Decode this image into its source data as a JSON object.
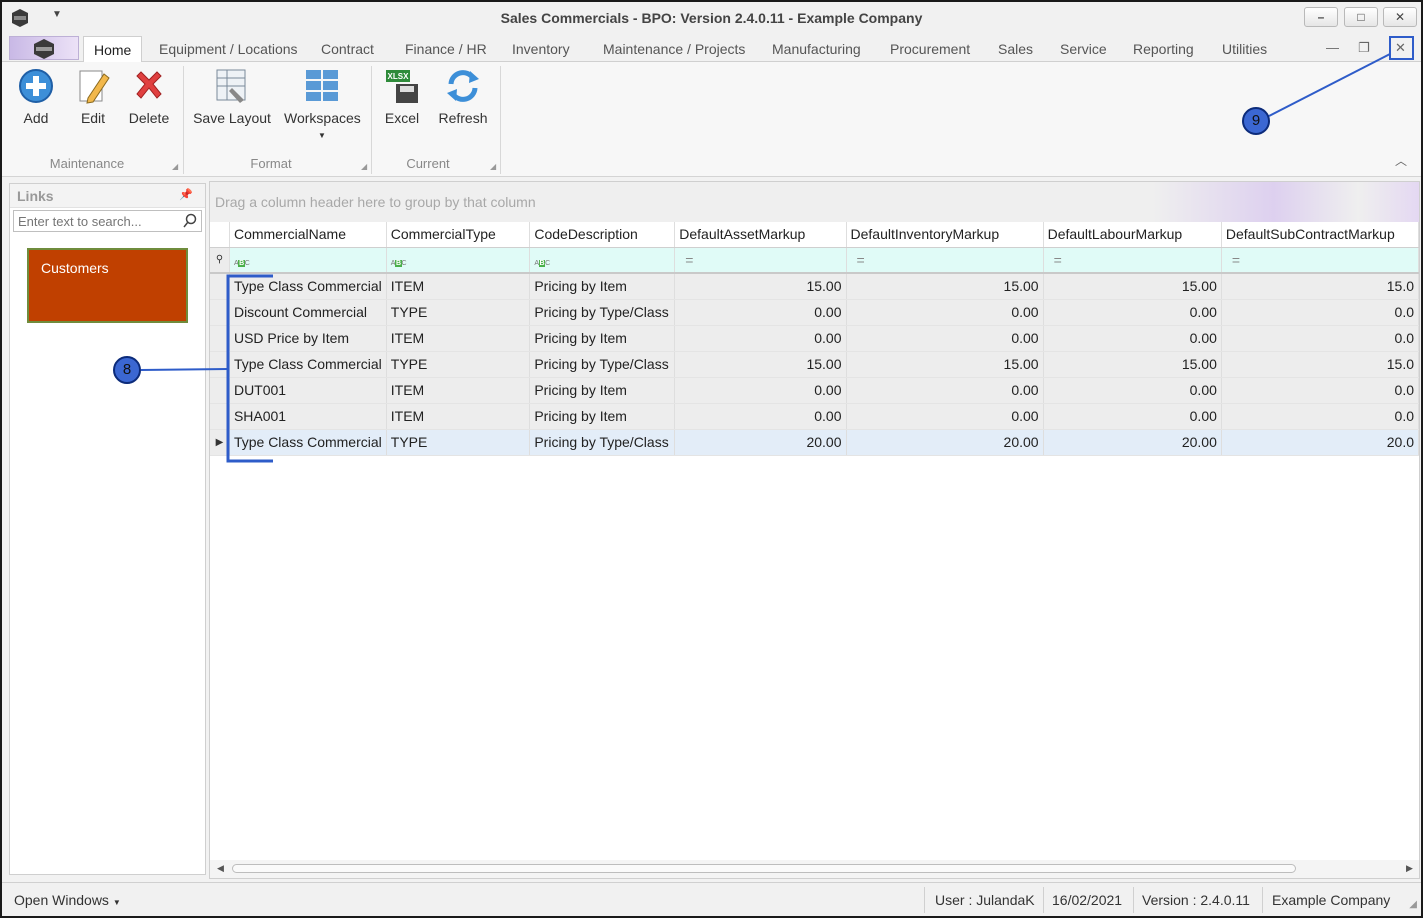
{
  "window": {
    "title": "Sales Commercials - BPO: Version 2.4.0.11 - Example Company",
    "controls": {
      "minimize": "–",
      "maximize": "□",
      "close": "✕"
    }
  },
  "tabs": [
    {
      "label": "Home",
      "active": true
    },
    {
      "label": "Equipment / Locations"
    },
    {
      "label": "Contract"
    },
    {
      "label": "Finance / HR"
    },
    {
      "label": "Inventory"
    },
    {
      "label": "Maintenance / Projects"
    },
    {
      "label": "Manufacturing"
    },
    {
      "label": "Procurement"
    },
    {
      "label": "Sales"
    },
    {
      "label": "Service"
    },
    {
      "label": "Reporting"
    },
    {
      "label": "Utilities"
    }
  ],
  "ribbon": {
    "maintenance": {
      "label": "Maintenance",
      "add": "Add",
      "edit": "Edit",
      "delete": "Delete"
    },
    "format": {
      "label": "Format",
      "save_layout": "Save Layout",
      "workspaces": "Workspaces"
    },
    "current": {
      "label": "Current",
      "excel": "Excel",
      "refresh": "Refresh",
      "excel_badge": "XLSX"
    }
  },
  "links": {
    "title": "Links",
    "search_placeholder": "Enter text to search...",
    "tile": "Customers"
  },
  "grid": {
    "group_hint": "Drag a column header here to group by that column",
    "columns": [
      "CommercialName",
      "CommercialType",
      "CodeDescription",
      "DefaultAssetMarkup",
      "DefaultInventoryMarkup",
      "DefaultLabourMarkup",
      "DefaultSubContractMarkup"
    ],
    "rows": [
      [
        "Type Class Commercial",
        "ITEM",
        "Pricing by Item",
        "15.00",
        "15.00",
        "15.00",
        "15.0"
      ],
      [
        "Discount Commercial",
        "TYPE",
        "Pricing by Type/Class",
        "0.00",
        "0.00",
        "0.00",
        "0.0"
      ],
      [
        "USD Price by Item",
        "ITEM",
        "Pricing by Item",
        "0.00",
        "0.00",
        "0.00",
        "0.0"
      ],
      [
        "Type Class Commercial",
        "TYPE",
        "Pricing by Type/Class",
        "15.00",
        "15.00",
        "15.00",
        "15.0"
      ],
      [
        "DUT001",
        "ITEM",
        "Pricing by Item",
        "0.00",
        "0.00",
        "0.00",
        "0.0"
      ],
      [
        "SHA001",
        "ITEM",
        "Pricing by Item",
        "0.00",
        "0.00",
        "0.00",
        "0.0"
      ],
      [
        "Type Class Commercial",
        "TYPE",
        "Pricing by Type/Class",
        "20.00",
        "20.00",
        "20.00",
        "20.0"
      ]
    ],
    "selected_row": 6
  },
  "status": {
    "open_windows": "Open Windows",
    "user": "User : JulandaK",
    "date": "16/02/2021",
    "version": "Version : 2.4.0.11",
    "company": "Example Company"
  },
  "callouts": {
    "c8": "8",
    "c9": "9"
  },
  "colors": {
    "tile": "#c04000",
    "callout": "#3b67d2",
    "filter_row": "#e0fbf7"
  }
}
